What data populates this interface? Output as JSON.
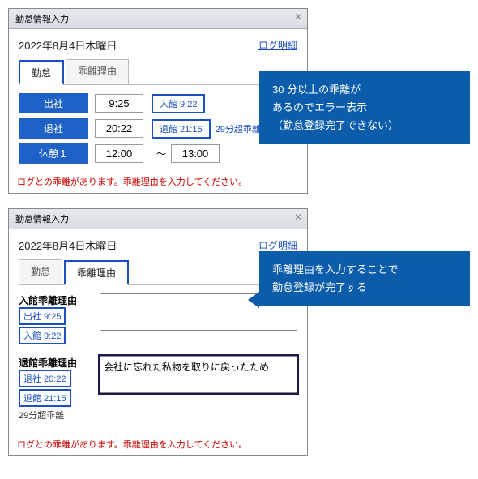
{
  "dialog1": {
    "title": "勤怠情報入力",
    "date": "2022年8月4日木曜日",
    "log_link": "ログ明細",
    "tabs": {
      "kintai": "勤怠",
      "reason": "乖離理由"
    },
    "rows": {
      "arrive": {
        "label": "出社",
        "time": "9:25",
        "badge": "入館 9:22"
      },
      "leave": {
        "label": "退社",
        "time": "20:22",
        "badge": "退館 21:15",
        "gap": "29分超乖離"
      },
      "break1": {
        "label": "休憩１",
        "from": "12:00",
        "to": "13:00"
      }
    },
    "error": "ログとの乖離があります。乖離理由を入力してください。"
  },
  "dialog2": {
    "title": "勤怠情報入力",
    "date": "2022年8月4日木曜日",
    "log_link": "ログ明細",
    "tabs": {
      "kintai": "勤怠",
      "reason": "乖離理由"
    },
    "sections": {
      "enter": {
        "label": "入館乖離理由",
        "b1": "出社 9:25",
        "b2": "入館 9:22",
        "text": ""
      },
      "exit": {
        "label": "退館乖離理由",
        "b1": "退社 20:22",
        "b2": "退館 21:15",
        "gap": "29分超乖離",
        "text": "会社に忘れた私物を取りに戻ったため"
      }
    },
    "error": "ログとの乖離があります。乖離理由を入力してください。"
  },
  "callouts": {
    "c1a": "30 分以上の乖離が",
    "c1b": "あるのでエラー表示",
    "c1c": "（勤怠登録完了できない）",
    "c2a": "乖離理由を入力することで",
    "c2b": "勤怠登録が完了する"
  },
  "sep": "～"
}
